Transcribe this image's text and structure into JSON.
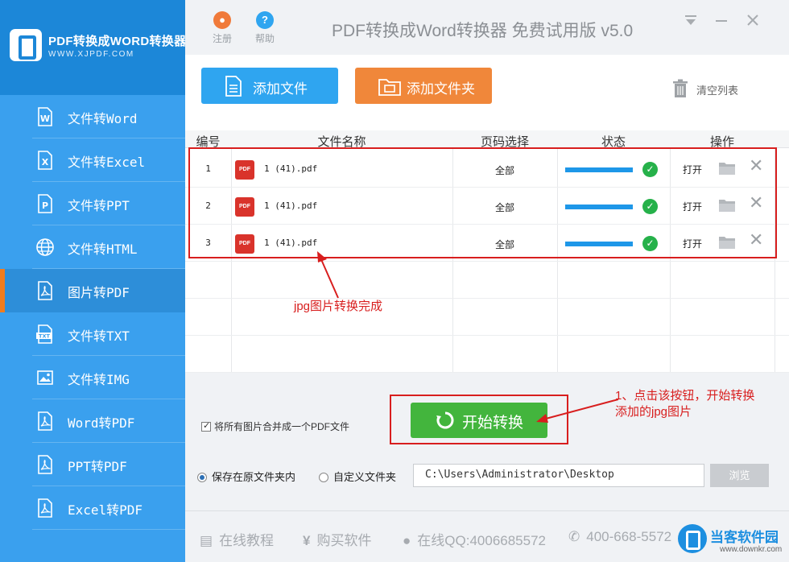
{
  "brand": {
    "title": "PDF转换成WORD转换器",
    "url": "WWW.XJPDF.COM"
  },
  "titlebar": {
    "register_label": "注册",
    "help_label": "帮助",
    "app_title": "PDF转换成Word转换器 免费试用版 v5.0"
  },
  "sidebar": {
    "items": [
      {
        "label": "文件转Word",
        "icon": "word-file-icon"
      },
      {
        "label": "文件转Excel",
        "icon": "excel-file-icon"
      },
      {
        "label": "文件转PPT",
        "icon": "ppt-file-icon"
      },
      {
        "label": "文件转HTML",
        "icon": "globe-icon"
      },
      {
        "label": "图片转PDF",
        "icon": "pdf-file-icon",
        "active": true
      },
      {
        "label": "文件转TXT",
        "icon": "txt-file-icon"
      },
      {
        "label": "文件转IMG",
        "icon": "image-file-icon"
      },
      {
        "label": "Word转PDF",
        "icon": "pdf-file-icon"
      },
      {
        "label": "PPT转PDF",
        "icon": "pdf-file-icon"
      },
      {
        "label": "Excel转PDF",
        "icon": "pdf-file-icon"
      }
    ]
  },
  "toolbar": {
    "add_file_label": "添加文件",
    "add_folder_label": "添加文件夹",
    "clear_list_label": "清空列表"
  },
  "table": {
    "headers": [
      "编号",
      "文件名称",
      "页码选择",
      "状态",
      "操作"
    ],
    "rows": [
      {
        "no": "1",
        "name": "1 (41).pdf",
        "pages": "全部",
        "progress": 100,
        "action": "打开"
      },
      {
        "no": "2",
        "name": "1 (41).pdf",
        "pages": "全部",
        "progress": 100,
        "action": "打开"
      },
      {
        "no": "3",
        "name": "1 (41).pdf",
        "pages": "全部",
        "progress": 100,
        "action": "打开"
      }
    ],
    "pdf_badge": "PDF"
  },
  "annotations": {
    "done_note": "jpg图片转换完成",
    "start_note_line1": "1、点击该按钮，开始转换",
    "start_note_line2": "添加的jpg图片"
  },
  "bottom": {
    "merge_label": "将所有图片合并成一个PDF文件",
    "merge_checked": true,
    "start_label": "开始转换",
    "save_original_label": "保存在原文件夹内",
    "save_custom_label": "自定义文件夹",
    "selected_option": "original",
    "path_value": "C:\\Users\\Administrator\\Desktop",
    "browse_label": "浏览"
  },
  "footer": {
    "tutorial_label": "在线教程",
    "buy_label": "购买软件",
    "qq_label": "在线QQ:4006685572",
    "phone_label": "400-668-5572"
  },
  "watermark": {
    "name": "当客软件园",
    "url": "www.downkr.com"
  },
  "colors": {
    "sidebar": "#3aa0ee",
    "accent_blue": "#2fa5f0",
    "accent_orange": "#f0873a",
    "start_green": "#43b53d",
    "annotation_red": "#d81e1e"
  }
}
